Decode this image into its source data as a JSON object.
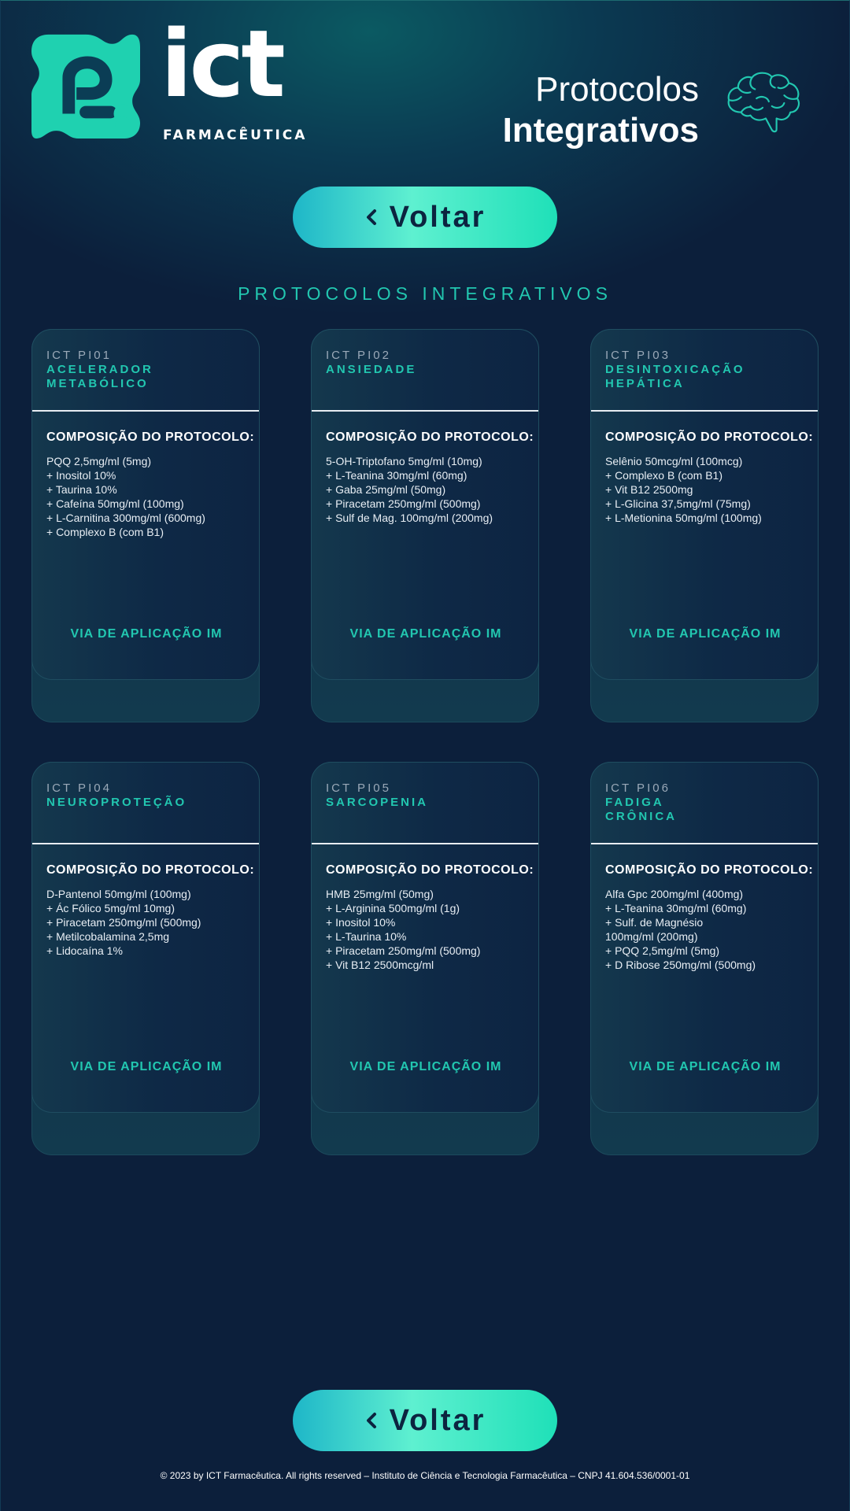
{
  "brand": {
    "name": "ict",
    "subtitle": "FARMACÊUTICA",
    "logo_color": "#1fd1b0"
  },
  "header": {
    "title_line1": "Protocolos",
    "title_line2": "Integrativos",
    "icon": "brain-icon"
  },
  "back_button": {
    "label": "Voltar",
    "icon": "chevron-left-icon"
  },
  "section_title": "PROTOCOLOS INTEGRATIVOS",
  "cards": [
    {
      "code": "ICT PI01",
      "name": "ACELERADOR\nMETABÓLICO",
      "composition_title": "COMPOSIÇÃO DO PROTOCOLO:",
      "items": [
        "PQQ 2,5mg/ml (5mg)",
        "+ Inositol 10%",
        "+ Taurina 10%",
        "+ Cafeína 50mg/ml (100mg)",
        "+ L-Carnitina 300mg/ml (600mg)",
        "+ Complexo B (com B1)"
      ],
      "route": "VIA DE APLICAÇÃO IM"
    },
    {
      "code": "ICT PI02",
      "name": "ANSIEDADE",
      "composition_title": "COMPOSIÇÃO DO PROTOCOLO:",
      "items": [
        "5-OH-Triptofano 5mg/ml (10mg)",
        "+ L-Teanina 30mg/ml (60mg)",
        "+ Gaba 25mg/ml (50mg)",
        "+ Piracetam 250mg/ml (500mg)",
        "+ Sulf de Mag. 100mg/ml (200mg)"
      ],
      "route": "VIA DE APLICAÇÃO IM"
    },
    {
      "code": "ICT PI03",
      "name": "DESINTOXICAÇÃO\nHEPÁTICA",
      "composition_title": "COMPOSIÇÃO DO PROTOCOLO:",
      "items": [
        "Selênio 50mcg/ml (100mcg)",
        "+ Complexo B (com B1)",
        "+ Vit B12 2500mg",
        "+ L-Glicina 37,5mg/ml (75mg)",
        "+ L-Metionina 50mg/ml (100mg)"
      ],
      "route": "VIA DE APLICAÇÃO IM"
    },
    {
      "code": "ICT PI04",
      "name": "NEUROPROTEÇÃO",
      "composition_title": "COMPOSIÇÃO DO PROTOCOLO:",
      "items": [
        "D-Pantenol 50mg/ml (100mg)",
        "+ Ác Fólico 5mg/ml 10mg)",
        "+ Piracetam 250mg/ml (500mg)",
        "+ Metilcobalamina 2,5mg",
        "+ Lidocaína 1%"
      ],
      "route": "VIA DE APLICAÇÃO IM"
    },
    {
      "code": "ICT PI05",
      "name": "SARCOPENIA",
      "composition_title": "COMPOSIÇÃO DO PROTOCOLO:",
      "items": [
        "HMB 25mg/ml (50mg)",
        "+ L-Arginina 500mg/ml (1g)",
        "+ Inositol 10%",
        "+ L-Taurina 10%",
        "+ Piracetam 250mg/ml (500mg)",
        "+ Vit B12 2500mcg/ml"
      ],
      "route": "VIA DE APLICAÇÃO IM"
    },
    {
      "code": "ICT PI06",
      "name": "FADIGA\nCRÔNICA",
      "composition_title": "COMPOSIÇÃO DO PROTOCOLO:",
      "items": [
        "Alfa Gpc 200mg/ml (400mg)",
        "+ L-Teanina 30mg/ml (60mg)",
        "+ Sulf. de Magnésio",
        "100mg/ml (200mg)",
        "+ PQQ 2,5mg/ml (5mg)",
        "+ D Ribose 250mg/ml (500mg)"
      ],
      "route": "VIA DE APLICAÇÃO IM"
    }
  ],
  "footer": "© 2023 by ICT Farmacêutica. All rights reserved – Instituto de Ciência e Tecnologia Farmacêutica – CNPJ 41.604.536/0001-01",
  "colors": {
    "background": "#0c1f3b",
    "accent": "#22c7b0",
    "button_gradient_start": "#1eb6c8",
    "button_gradient_end": "#1fe0b8"
  }
}
